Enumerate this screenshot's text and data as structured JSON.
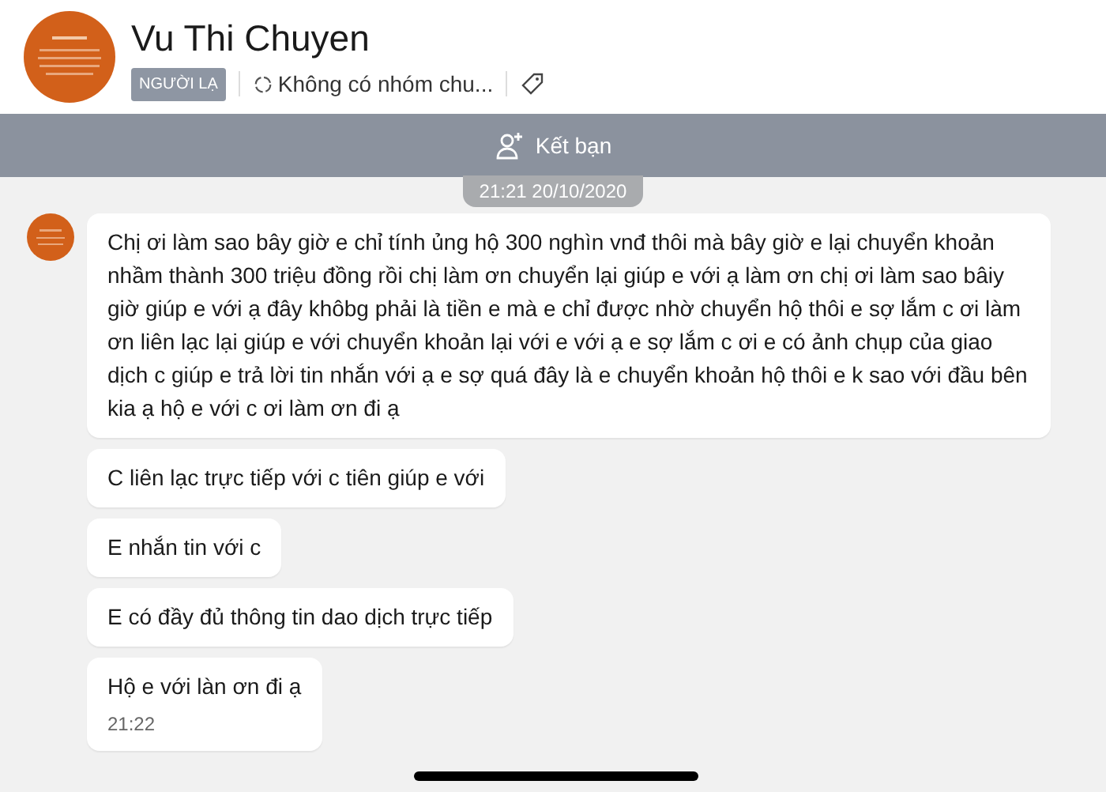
{
  "header": {
    "name": "Vu Thi Chuyen",
    "badge": "NGƯỜI LẠ",
    "group": "Không có nhóm chu..."
  },
  "action_bar": {
    "label": "Kết bạn"
  },
  "date_stamp": "21:21 20/10/2020",
  "messages": [
    {
      "text": "Chị ơi làm sao bây giờ e chỉ tính ủng hộ 300 nghìn vnđ thôi mà bây giờ e lại chuyển khoản nhầm thành 300 triệu đồng rồi chị làm ơn chuyển lại giúp e với ạ làm ơn chị ơi làm sao bâiy giờ giúp e với ạ đây khôbg phải là tiền e mà e chỉ được nhờ chuyển hộ thôi e sợ lắm c ơi làm ơn liên lạc lại giúp e với chuyển khoản lại với e với ạ e sợ lắm c ơi e có ảnh chụp của giao dịch c giúp e trả lời tin nhắn với ạ e sợ quá đây là e chuyển khoản hộ thôi e k sao với đầu bên kia ạ hộ e với c ơi làm ơn đi ạ"
    },
    {
      "text": "C liên lạc trực tiếp với c tiên giúp e với"
    },
    {
      "text": "E nhắn tin với c"
    },
    {
      "text": "E có đầy đủ thông tin dao dịch trực tiếp"
    },
    {
      "text": "Hộ e với làn ơn đi ạ",
      "time": "21:22"
    }
  ]
}
